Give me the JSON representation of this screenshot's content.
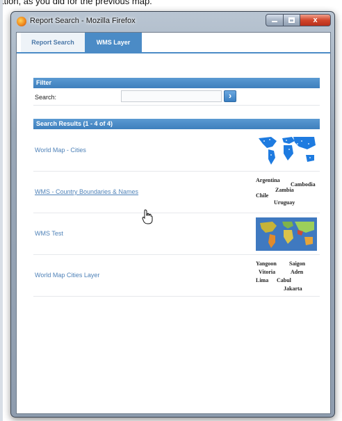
{
  "caption": "ttion, as you did for the previous map.",
  "window": {
    "title": "Report Search - Mozilla Firefox",
    "controls": {
      "minimize": "",
      "maximize": "",
      "close": "x"
    }
  },
  "tabs": [
    {
      "label": "Report Search",
      "active": false
    },
    {
      "label": "WMS Layer",
      "active": true
    }
  ],
  "filter": {
    "header": "Filter",
    "search_label": "Search:",
    "search_value": "",
    "search_button_glyph": "›"
  },
  "results": {
    "header": "Search Results (1 - 4 of 4)",
    "items": [
      {
        "label": "World Map - Cities",
        "thumbnail": "world-map-cities",
        "hovered": false
      },
      {
        "label": "WMS - Country Boundaries & Names",
        "thumbnail": "country-names-labels",
        "hovered": true
      },
      {
        "label": "WMS Test",
        "thumbnail": "colored-world-map",
        "hovered": false
      },
      {
        "label": "World Map Cities Layer",
        "thumbnail": "city-names-labels",
        "hovered": false
      }
    ]
  },
  "thumb_labels": {
    "country_names": [
      "Argentina",
      "Chile",
      "Uruguay",
      "Cambodia",
      "Zambia"
    ],
    "city_names": [
      "Yangoon",
      "Saigon",
      "Vitoria",
      "Aden",
      "Lima",
      "Cabul",
      "Jakarta"
    ]
  },
  "colors": {
    "tab_active": "#4b8bc6",
    "section_header": "#3e7fbd",
    "link": "#4f82b8",
    "window_frame": "#9aa8b8",
    "close_button": "#d1462c"
  }
}
